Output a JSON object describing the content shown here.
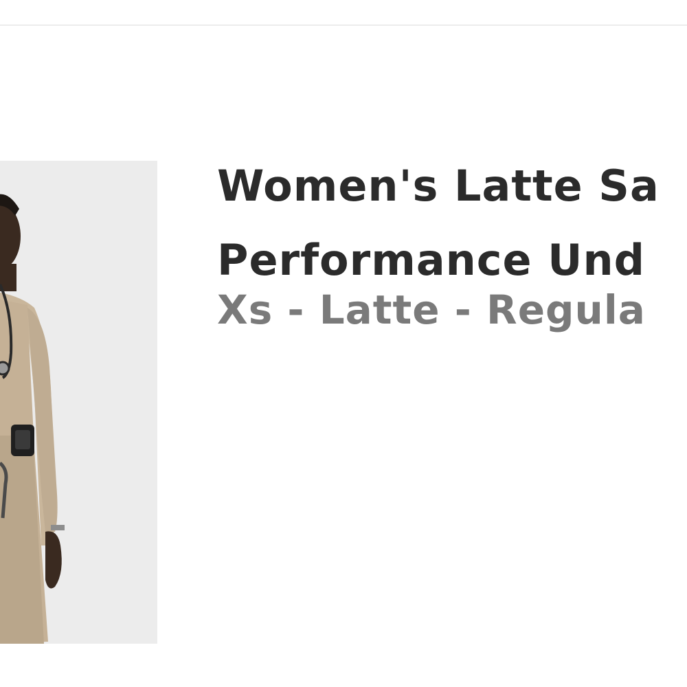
{
  "product": {
    "image_alt": "woman-wearing-latte-scrubs",
    "title_line_1": "Women's Latte Sa",
    "title_line_2": "Performance Und",
    "variant": "Xs - Latte - Regula"
  },
  "colors": {
    "title": "#2b2b2b",
    "variant": "#7a7a7a",
    "image_background": "#ececec",
    "garment": "#c8b59a",
    "divider": "#dcdcdc"
  }
}
